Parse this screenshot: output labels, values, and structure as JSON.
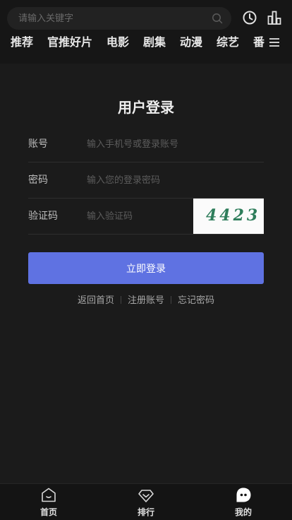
{
  "search": {
    "placeholder": "请输入关键字"
  },
  "nav": {
    "items": [
      "推荐",
      "官推好片",
      "电影",
      "剧集",
      "动漫",
      "综艺",
      "番"
    ]
  },
  "login": {
    "title": "用户登录",
    "account_label": "账号",
    "account_placeholder": "输入手机号或登录账号",
    "password_label": "密码",
    "password_placeholder": "输入您的登录密码",
    "captcha_label": "验证码",
    "captcha_placeholder": "输入验证码",
    "captcha_code": "4423",
    "submit_label": "立即登录"
  },
  "links": {
    "home": "返回首页",
    "register": "注册账号",
    "forgot": "忘记密码"
  },
  "tabbar": {
    "home": "首页",
    "rank": "排行",
    "mine": "我的"
  },
  "colors": {
    "accent": "#5f72e2",
    "background": "#1b1b1b"
  },
  "icons": [
    "search-icon",
    "clock-icon",
    "rank-icon",
    "menu-icon",
    "home-icon",
    "diamond-icon",
    "chat-icon"
  ]
}
